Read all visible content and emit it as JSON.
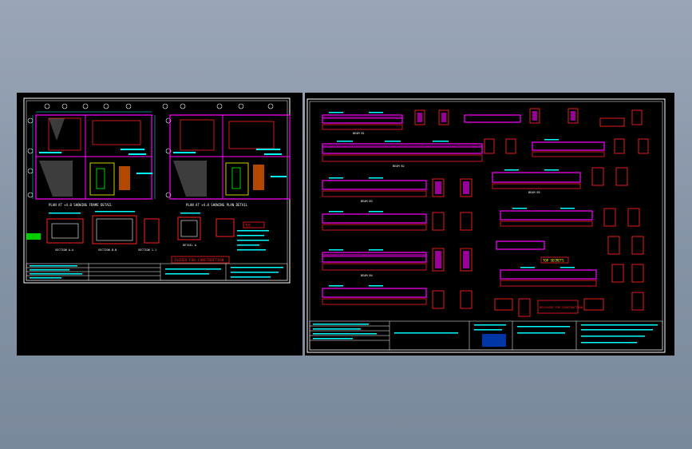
{
  "drawings": {
    "left": {
      "stamp_text": "ISSUED FOR CONSTRUCTION",
      "plan_captions": [
        "PLAN AT +4.0 SHOWING FRAME DETAIL",
        "PLAN AT +4.0 SHOWING PLAN DETAIL"
      ],
      "section_captions": [
        "SECTION A-A",
        "SECTION B-B",
        "SECTION 1-1",
        "DETAIL A"
      ],
      "tag": "TOC"
    },
    "right": {
      "stamp_text": "RELEASED FOR CONSTRUCTION",
      "tag": "TOP SECRETS",
      "beam_captions": [
        "BEAM B1",
        "BEAM B2",
        "BEAM B3",
        "BEAM B4",
        "BEAM B5"
      ]
    }
  },
  "colors": {
    "background": "#8b98ab",
    "sheet": "#000000",
    "border": "#ffffff",
    "magenta": "#ff00ff",
    "red": "#ff2020",
    "cyan": "#00ffff",
    "yellow": "#ffff00",
    "green": "#00ff00"
  }
}
